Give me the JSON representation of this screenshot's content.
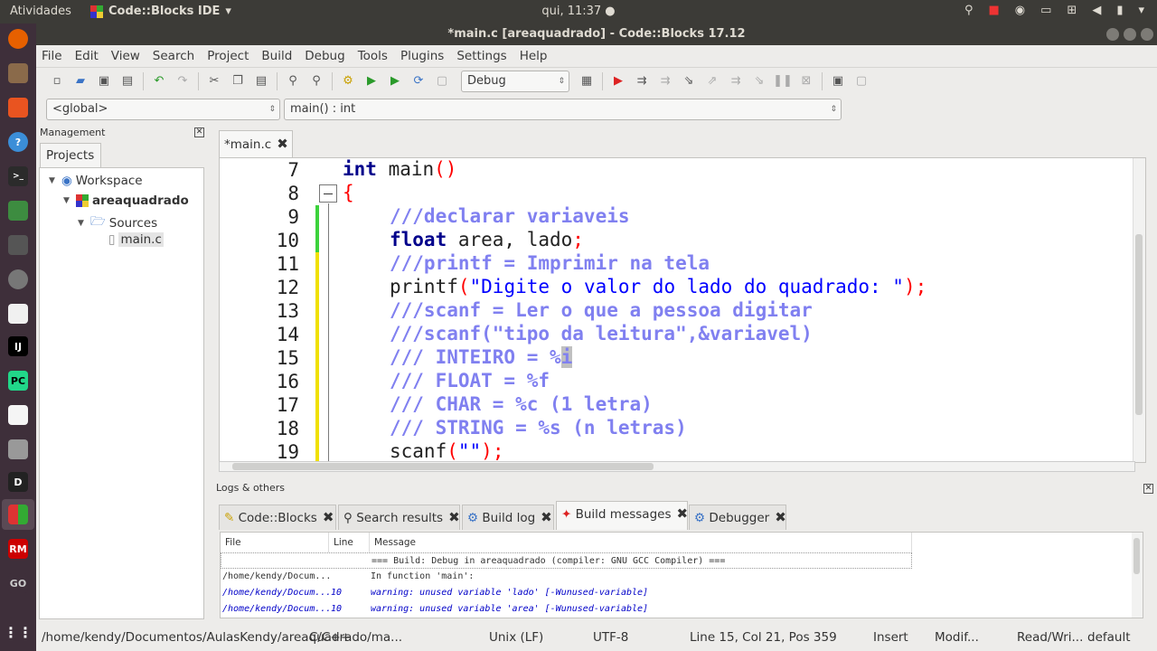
{
  "topbar": {
    "activities": "Atividades",
    "app_name": "Code::Blocks IDE",
    "clock": "qui, 11:37 ●"
  },
  "window": {
    "title": "*main.c [areaquadrado] - Code::Blocks 17.12"
  },
  "menu": [
    "File",
    "Edit",
    "View",
    "Search",
    "Project",
    "Build",
    "Debug",
    "Tools",
    "Plugins",
    "Settings",
    "Help"
  ],
  "toolbar": {
    "build_target": "Debug"
  },
  "scope": {
    "global": "<global>",
    "function": "main() : int"
  },
  "management": {
    "title": "Management",
    "tab": "Projects",
    "workspace": "Workspace",
    "project": "areaquadrado",
    "sources": "Sources",
    "file": "main.c"
  },
  "editor": {
    "tab": "*main.c",
    "line_numbers": [
      "7",
      "8",
      "9",
      "10",
      "11",
      "12",
      "13",
      "14",
      "15",
      "16",
      "17",
      "18",
      "19"
    ]
  },
  "code": {
    "l7a": "int",
    "l7b": " main",
    "l7c": "()",
    "l8": "{",
    "l9": "///declarar variaveis",
    "l10a": "float",
    "l10b": " area, lado",
    "l10c": ";",
    "l11": "///printf = Imprimir na tela",
    "l12a": "printf",
    "l12b": "(",
    "l12c": "\"Digite o valor do lado do quadrado: \"",
    "l12d": ");",
    "l13": "///scanf = Ler o que a pessoa digitar",
    "l14": "///scanf(\"tipo da leitura\",&variavel)",
    "l15a": "/// INTEIRO = %",
    "l15b": "i",
    "l16": "/// FLOAT = %f",
    "l17": "/// CHAR = %c (1 letra)",
    "l18": "/// STRING = %s (n letras)",
    "l19a": "scanf",
    "l19b": "(",
    "l19c": "\"\"",
    "l19d": ");"
  },
  "logs": {
    "title": "Logs & others",
    "tabs": [
      "Code::Blocks",
      "Search results",
      "Build log",
      "Build messages",
      "Debugger"
    ],
    "columns": [
      "File",
      "Line",
      "Message"
    ],
    "rows": [
      {
        "file": "",
        "line": "",
        "message": "=== Build: Debug in areaquadrado (compiler: GNU GCC Compiler) ==="
      },
      {
        "file": "/home/kendy/Docum...",
        "line": "",
        "message": "In function 'main':"
      },
      {
        "file": "/home/kendy/Docum...",
        "line": "10",
        "message": "warning: unused variable 'lado' [-Wunused-variable]"
      },
      {
        "file": "/home/kendy/Docum...",
        "line": "10",
        "message": "warning: unused variable 'area' [-Wunused-variable]"
      }
    ]
  },
  "status": {
    "path": "/home/kendy/Documentos/AulasKendy/areaquadrado/ma...",
    "lang": "C/C++",
    "eol": "Unix (LF)",
    "enc": "UTF-8",
    "pos": "Line 15, Col 21, Pos 359",
    "mode": "Insert",
    "mod": "Modif...",
    "rw": "Read/Wri...",
    "profile": "default"
  }
}
